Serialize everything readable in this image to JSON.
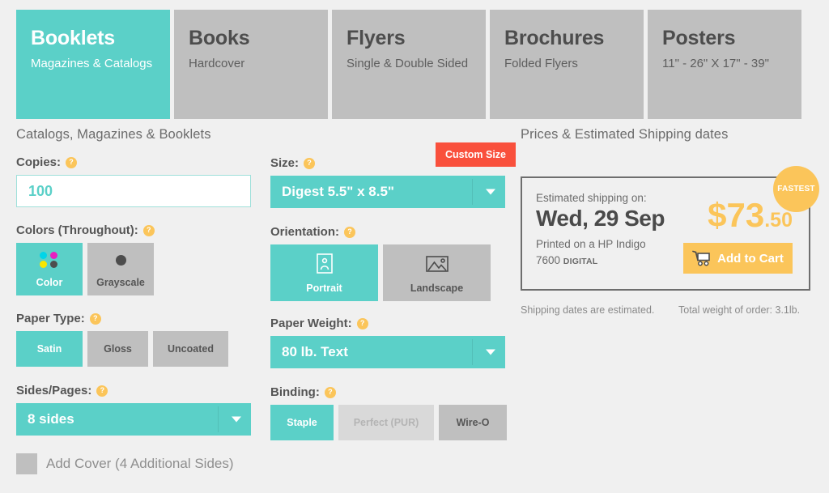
{
  "tabs": [
    {
      "title": "Booklets",
      "sub": "Magazines & Catalogs",
      "active": true
    },
    {
      "title": "Books",
      "sub": "Hardcover",
      "active": false
    },
    {
      "title": "Flyers",
      "sub": "Single & Double Sided",
      "active": false
    },
    {
      "title": "Brochures",
      "sub": "Folded Flyers",
      "active": false
    },
    {
      "title": "Posters",
      "sub": "11\" - 26\" X 17\" - 39\"",
      "active": false
    }
  ],
  "left": {
    "section_title": "Catalogs, Magazines & Booklets",
    "copies": {
      "label": "Copies:",
      "value": "100",
      "placeholder": "100"
    },
    "colors": {
      "label": "Colors (Throughout):",
      "options": [
        {
          "label": "Color",
          "icon": "cmyk-dots-icon",
          "selected": true
        },
        {
          "label": "Grayscale",
          "icon": "gray-dot-icon",
          "selected": false
        }
      ]
    },
    "paper_type": {
      "label": "Paper Type:",
      "options": [
        {
          "label": "Satin",
          "selected": true
        },
        {
          "label": "Gloss",
          "selected": false
        },
        {
          "label": "Uncoated",
          "selected": false
        }
      ]
    },
    "sides_pages": {
      "label": "Sides/Pages:",
      "value": "8 sides"
    },
    "add_cover": {
      "label": "Add Cover (4 Additional Sides)",
      "checked": false
    }
  },
  "mid": {
    "size": {
      "label": "Size:",
      "value": "Digest 5.5\" x 8.5\"",
      "custom_button": "Custom Size"
    },
    "orientation": {
      "label": "Orientation:",
      "options": [
        {
          "label": "Portrait",
          "icon": "portrait-icon",
          "selected": true
        },
        {
          "label": "Landscape",
          "icon": "landscape-icon",
          "selected": false
        }
      ]
    },
    "paper_weight": {
      "label": "Paper Weight:",
      "value": "80 lb. Text"
    },
    "binding": {
      "label": "Binding:",
      "options": [
        {
          "label": "Staple",
          "selected": true,
          "disabled": false
        },
        {
          "label": "Perfect (PUR)",
          "selected": false,
          "disabled": true
        },
        {
          "label": "Wire-O",
          "selected": false,
          "disabled": false
        }
      ]
    }
  },
  "right": {
    "section_title": "Prices & Estimated Shipping dates",
    "badge": "FASTEST",
    "estimated_label": "Estimated shipping on:",
    "ship_date": "Wed, 29 Sep",
    "printed_line1": "Printed on a HP Indigo",
    "printed_line2_num": "7600 ",
    "printed_line2_tag": "DIGITAL",
    "price_amount": "$73",
    "price_cents": ".50",
    "cart_button": "Add to Cart",
    "note_left": "Shipping dates are estimated.",
    "note_right": "Total weight of order: 3.1lb."
  },
  "colors": {
    "teal": "#5bd0c8",
    "gray": "#bfbfbf",
    "gray_disabled": "#d9d9d9",
    "amber": "#fbc55a",
    "red": "#f9503c",
    "page_bg": "#f0f0f0"
  }
}
